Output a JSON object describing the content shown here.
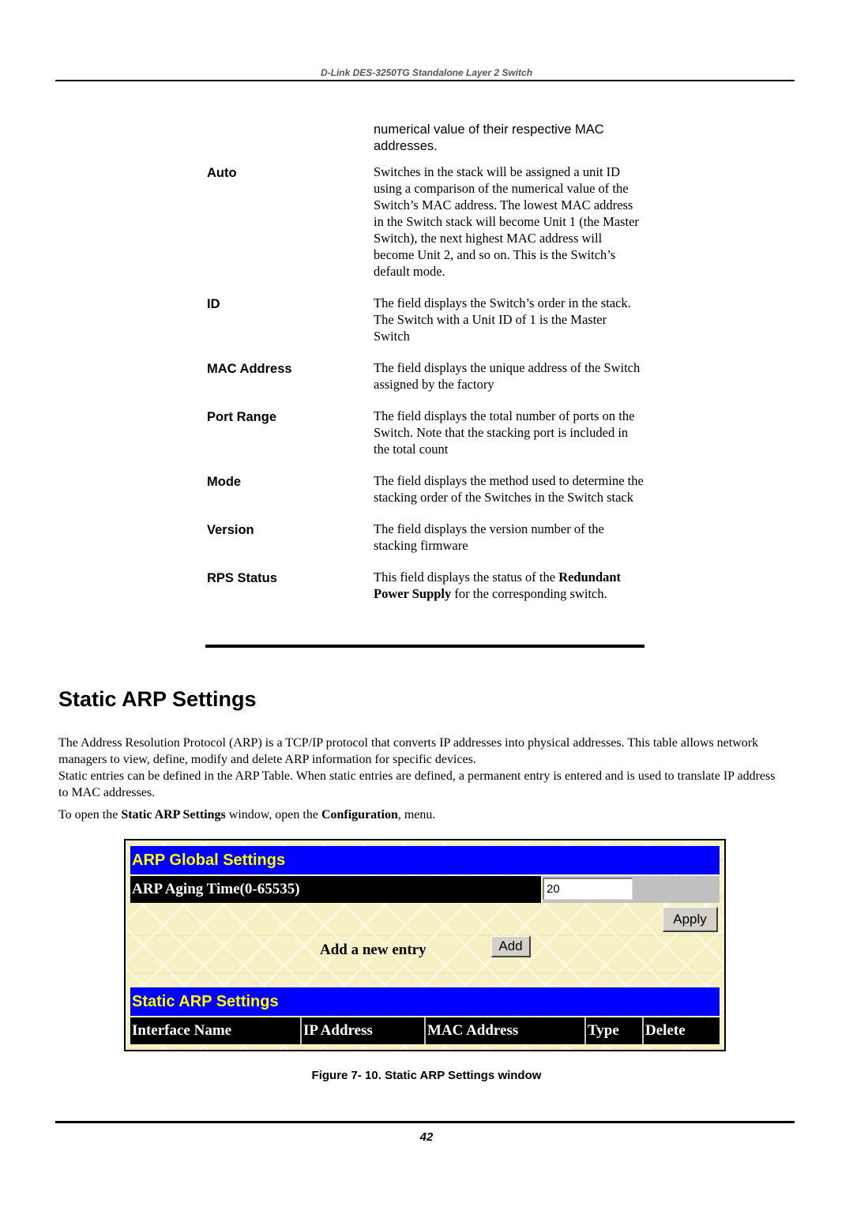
{
  "header": {
    "title": "D-Link DES-3250TG Standalone Layer 2 Switch"
  },
  "definitions": [
    {
      "term": "",
      "desc": "numerical value of their respective MAC addresses."
    },
    {
      "term": "Auto",
      "desc": "Switches in the stack will be assigned a unit ID using a comparison of the numerical value of the Switch’s MAC address.  The lowest MAC address in the Switch stack will become Unit 1 (the Master Switch), the next highest MAC address will become Unit 2, and so on.  This is the Switch’s default mode."
    },
    {
      "term": "ID",
      "desc": "The field displays the Switch’s order in the stack.  The Switch with a Unit ID of 1 is the Master Switch"
    },
    {
      "term": "MAC Address",
      "desc": "The field displays the unique address of the Switch assigned by the factory"
    },
    {
      "term": "Port Range",
      "desc": "The field displays the total number of ports on the Switch.  Note that the stacking port is included in the total count"
    },
    {
      "term": "Mode",
      "desc": "The field displays the method used to determine the stacking order of the Switches in the Switch stack"
    },
    {
      "term": "Version",
      "desc": "The field displays the version number of the stacking firmware"
    },
    {
      "term": "RPS Status",
      "desc_pre": "This field displays the status of the ",
      "desc_bold": "Redundant Power Supply",
      "desc_post": " for the corresponding switch."
    }
  ],
  "section": {
    "title": "Static ARP Settings",
    "para1": "The Address Resolution Protocol (ARP) is a TCP/IP protocol that converts IP addresses into physical addresses. This table allows network managers to view, define, modify and delete ARP information for specific devices.",
    "para2": "Static entries can be defined in the ARP Table. When static entries are defined, a permanent entry is entered and is used to translate IP address to MAC addresses.",
    "para3_pre": "To open the ",
    "para3_bold1": "Static ARP Settings",
    "para3_mid": " window, open the ",
    "para3_bold2": "Configuration",
    "para3_post": ", menu."
  },
  "figure": {
    "global_title": "ARP Global Settings",
    "aging_label": "ARP Aging Time(0-65535)",
    "aging_value": "20",
    "apply_label": "Apply",
    "add_entry_label": "Add a new entry",
    "add_label": "Add",
    "static_title": "Static ARP Settings",
    "columns": [
      "Interface Name",
      "IP Address",
      "MAC Address",
      "Type",
      "Delete"
    ],
    "colors": {
      "title_bg": "#0000ff",
      "title_fg": "#ffff00",
      "header_bg": "#000000"
    }
  },
  "caption": "Figure 7- 10. Static ARP Settings window",
  "footer": {
    "page_number": "42"
  }
}
